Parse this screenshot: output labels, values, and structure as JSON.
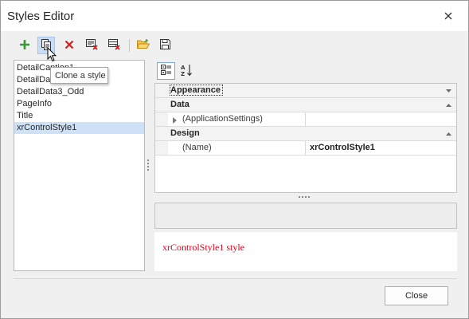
{
  "window": {
    "title": "Styles Editor"
  },
  "toolbar": {
    "buttons": [
      {
        "icon": "plus-icon",
        "color": "#3a9a3a"
      },
      {
        "icon": "clone-icon"
      },
      {
        "icon": "delete-icon",
        "color": "#d11f1f"
      },
      {
        "icon": "purge-icon"
      },
      {
        "icon": "clear-icon"
      },
      {
        "icon": "open-folder-icon",
        "color": "#e0a21d"
      },
      {
        "icon": "save-icon"
      }
    ]
  },
  "tooltip": {
    "text": "Clone a style"
  },
  "style_list": {
    "items": [
      "DetailCaption1",
      "DetailData1",
      "DetailData3_Odd",
      "PageInfo",
      "Title",
      "xrControlStyle1"
    ],
    "selected_index": 5
  },
  "property_grid": {
    "categories": [
      {
        "label": "Appearance",
        "collapsed": true,
        "focused": true
      },
      {
        "label": "Data",
        "collapsed": false
      },
      {
        "label": "Design",
        "collapsed": false
      }
    ],
    "rows": [
      {
        "name": "(ApplicationSettings)",
        "value": ""
      },
      {
        "name": "(Name)",
        "value": "xrControlStyle1"
      }
    ]
  },
  "preview": {
    "text": "xrControlStyle1 style",
    "color": "#e3001b"
  },
  "footer": {
    "close_label": "Close"
  }
}
